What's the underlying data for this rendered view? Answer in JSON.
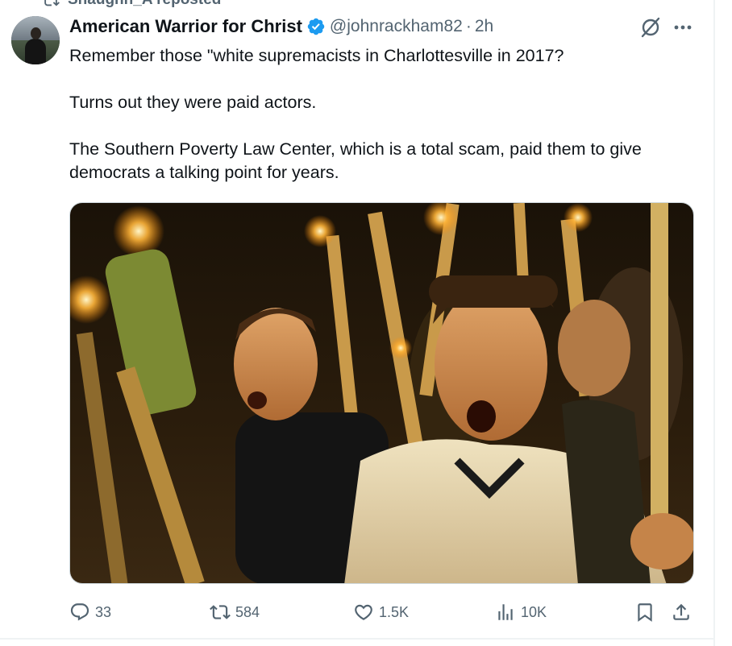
{
  "social_context": {
    "text": "Shaughn_A reposted",
    "icon": "repost-icon"
  },
  "tweet": {
    "display_name": "American Warrior for Christ",
    "verified": true,
    "verified_color": "#1d9bf0",
    "handle": "@johnrackham82",
    "separator": "·",
    "time": "2h",
    "text_lines": [
      "Remember those \"white supremacists in Charlottesville in 2017?",
      "Turns out they were paid actors.",
      "The Southern Poverty Law Center, which is a total scam, paid them to give democrats a talking point for years."
    ],
    "media": {
      "type": "photo",
      "alt": "Torch-lit rally with men shouting"
    }
  },
  "actions": {
    "reply": {
      "icon": "reply-icon",
      "count": "33"
    },
    "repost": {
      "icon": "repost-icon",
      "count": "584"
    },
    "like": {
      "icon": "heart-icon",
      "count": "1.5K"
    },
    "views": {
      "icon": "analytics-icon",
      "count": "10K"
    },
    "bookmark": {
      "icon": "bookmark-icon"
    },
    "share": {
      "icon": "share-icon"
    }
  },
  "colors": {
    "text_primary": "#0f1419",
    "text_secondary": "#536471",
    "border": "#cfd9de"
  }
}
